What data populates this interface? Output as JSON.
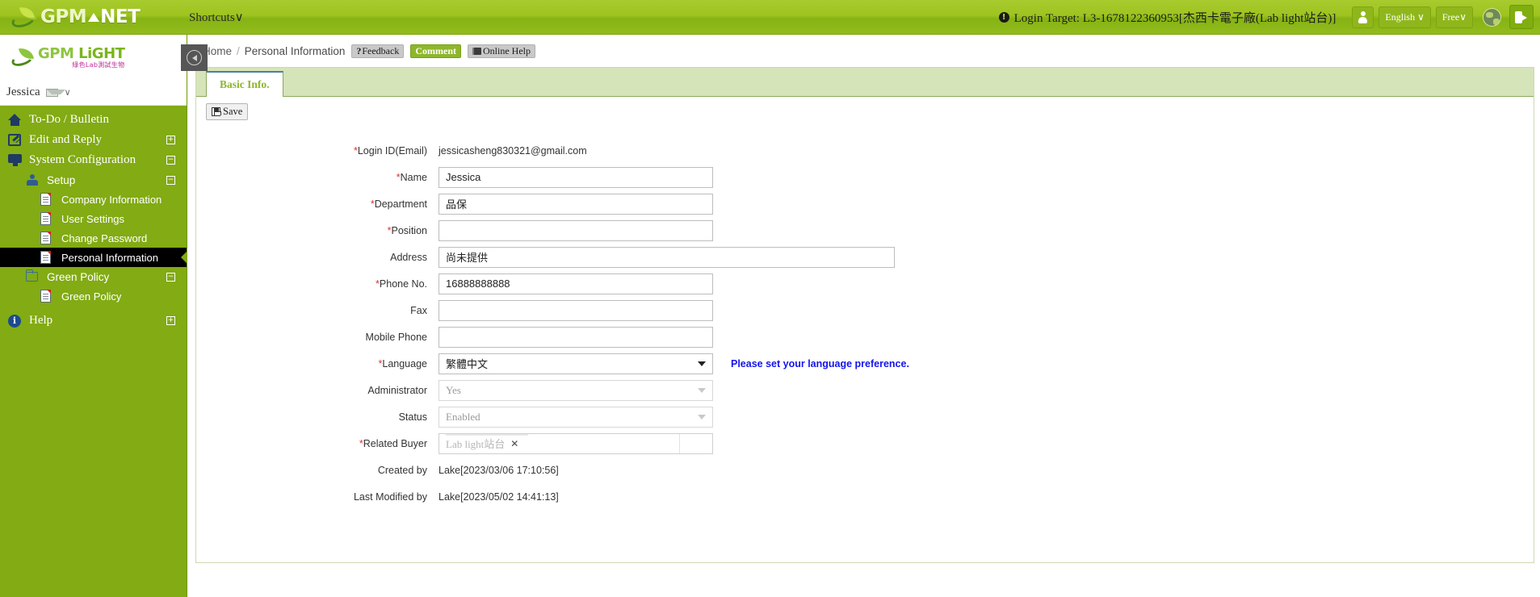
{
  "header": {
    "brand_gpm": "GPM",
    "brand_net": "NET",
    "shortcuts_label": "Shortcuts",
    "shortcuts_caret": "∨",
    "login_target": "Login Target: L3-1678122360953[杰西卡電子廠(Lab light站台)]",
    "info_icon": "!",
    "user_icon": "user-avatar-icon",
    "language_button": "English",
    "language_caret": "∨",
    "plan_button": "Free",
    "plan_caret": "∨",
    "globe_icon": "globe-icon",
    "logout_icon": "logout-icon"
  },
  "sidebar": {
    "logo_main_g": "GPM ",
    "logo_main_l": "LiGHT",
    "logo_sub": "綠色Lab測試生物",
    "user_name": "Jessica",
    "user_caret": "∨",
    "collapse_icon": "collapse-left-icon",
    "items": [
      {
        "label": "To-Do / Bulletin",
        "icon": "home-icon",
        "expander": ""
      },
      {
        "label": "Edit and Reply",
        "icon": "edit-icon",
        "expander": "+"
      },
      {
        "label": "System Configuration",
        "icon": "monitor-icon",
        "expander": "−"
      }
    ],
    "setup": {
      "label": "Setup",
      "icon": "setup-icon",
      "expander": "−",
      "children": [
        {
          "label": "Company Information",
          "icon": "document-icon",
          "active": false
        },
        {
          "label": "User Settings",
          "icon": "document-icon",
          "active": false
        },
        {
          "label": "Change Password",
          "icon": "document-icon",
          "active": false
        },
        {
          "label": "Personal Information",
          "icon": "document-icon",
          "active": true
        }
      ]
    },
    "green_policy": {
      "label": "Green Policy",
      "icon": "folder-icon",
      "expander": "−",
      "children": [
        {
          "label": "Green Policy",
          "icon": "document-icon"
        }
      ]
    },
    "help": {
      "label": "Help",
      "icon": "info-icon",
      "expander": "+"
    }
  },
  "breadcrumb": {
    "home": "Home",
    "separator": "/",
    "current": "Personal Information"
  },
  "actions": {
    "feedback_mark": "?",
    "feedback": "Feedback",
    "comment": "Comment",
    "online_help": "Online Help"
  },
  "panel": {
    "tab_label": "Basic Info.",
    "save_label": "Save"
  },
  "form": {
    "fields": [
      {
        "label": "Login ID(Email)",
        "required": true,
        "type": "static",
        "value": "jessicasheng830321@gmail.com"
      },
      {
        "label": "Name",
        "required": true,
        "type": "text",
        "value": "Jessica",
        "width": "w340"
      },
      {
        "label": "Department",
        "required": true,
        "type": "text",
        "value": "品保",
        "width": "w340"
      },
      {
        "label": "Position",
        "required": true,
        "type": "text",
        "value": "",
        "width": "w340"
      },
      {
        "label": "Address",
        "required": false,
        "type": "text",
        "value": "尚未提供",
        "width": "w565"
      },
      {
        "label": "Phone No.",
        "required": true,
        "type": "text",
        "value": "16888888888",
        "width": "w340"
      },
      {
        "label": "Fax",
        "required": false,
        "type": "text",
        "value": "",
        "width": "w340"
      },
      {
        "label": "Mobile Phone",
        "required": false,
        "type": "text",
        "value": "",
        "width": "w340"
      },
      {
        "label": "Language",
        "required": true,
        "type": "select",
        "value": "繁體中文",
        "width": "w340",
        "disabled": false,
        "hint": "Please set your language preference."
      },
      {
        "label": "Administrator",
        "required": false,
        "type": "select",
        "value": "Yes",
        "width": "w340",
        "disabled": true
      },
      {
        "label": "Status",
        "required": false,
        "type": "select",
        "value": "Enabled",
        "width": "w340",
        "disabled": true
      },
      {
        "label": "Related Buyer",
        "required": true,
        "type": "tagpicker",
        "value": "Lab light站台",
        "remove_icon": "✕"
      },
      {
        "label": "Created by",
        "required": false,
        "type": "static",
        "value": "Lake[2023/03/06 17:10:56]"
      },
      {
        "label": "Last Modified by",
        "required": false,
        "type": "static",
        "value": "Lake[2023/05/02 14:41:13]"
      }
    ]
  },
  "colors": {
    "brand_green": "#82ab14",
    "header_green": "#9ec41f",
    "tab_green": "#8db72b",
    "panel_border": "#cdd9b3",
    "required_red": "#e03131",
    "link_blue": "#1414ee",
    "active_black": "#000000"
  }
}
